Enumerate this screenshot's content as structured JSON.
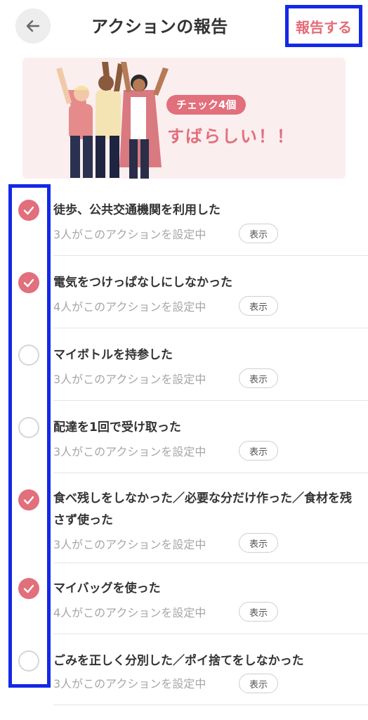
{
  "header": {
    "title": "アクションの報告",
    "report_label": "報告する",
    "back_icon": "arrow-left-icon"
  },
  "banner": {
    "badge": "チェック4個",
    "message": "すばらしい！！"
  },
  "colors": {
    "accent": "#e26f7c",
    "highlight": "#1428e6"
  },
  "actions": [
    {
      "title": "徒歩、公共交通機関を利用した",
      "sub": "3人がこのアクションを設定中",
      "show": "表示",
      "checked": true
    },
    {
      "title": "電気をつけっぱなしにしなかった",
      "sub": "4人がこのアクションを設定中",
      "show": "表示",
      "checked": true
    },
    {
      "title": "マイボトルを持参した",
      "sub": "3人がこのアクションを設定中",
      "show": "表示",
      "checked": false
    },
    {
      "title": "配達を1回で受け取った",
      "sub": "3人がこのアクションを設定中",
      "show": "表示",
      "checked": false
    },
    {
      "title": "食べ残しをしなかった／必要な分だけ作った／食材を残さず使った",
      "sub": "3人がこのアクションを設定中",
      "show": "表示",
      "checked": true
    },
    {
      "title": "マイバッグを使った",
      "sub": "4人がこのアクションを設定中",
      "show": "表示",
      "checked": true
    },
    {
      "title": "ごみを正しく分別した／ポイ捨てをしなかった",
      "sub": "3人がこのアクションを設定中",
      "show": "表示",
      "checked": false
    }
  ]
}
